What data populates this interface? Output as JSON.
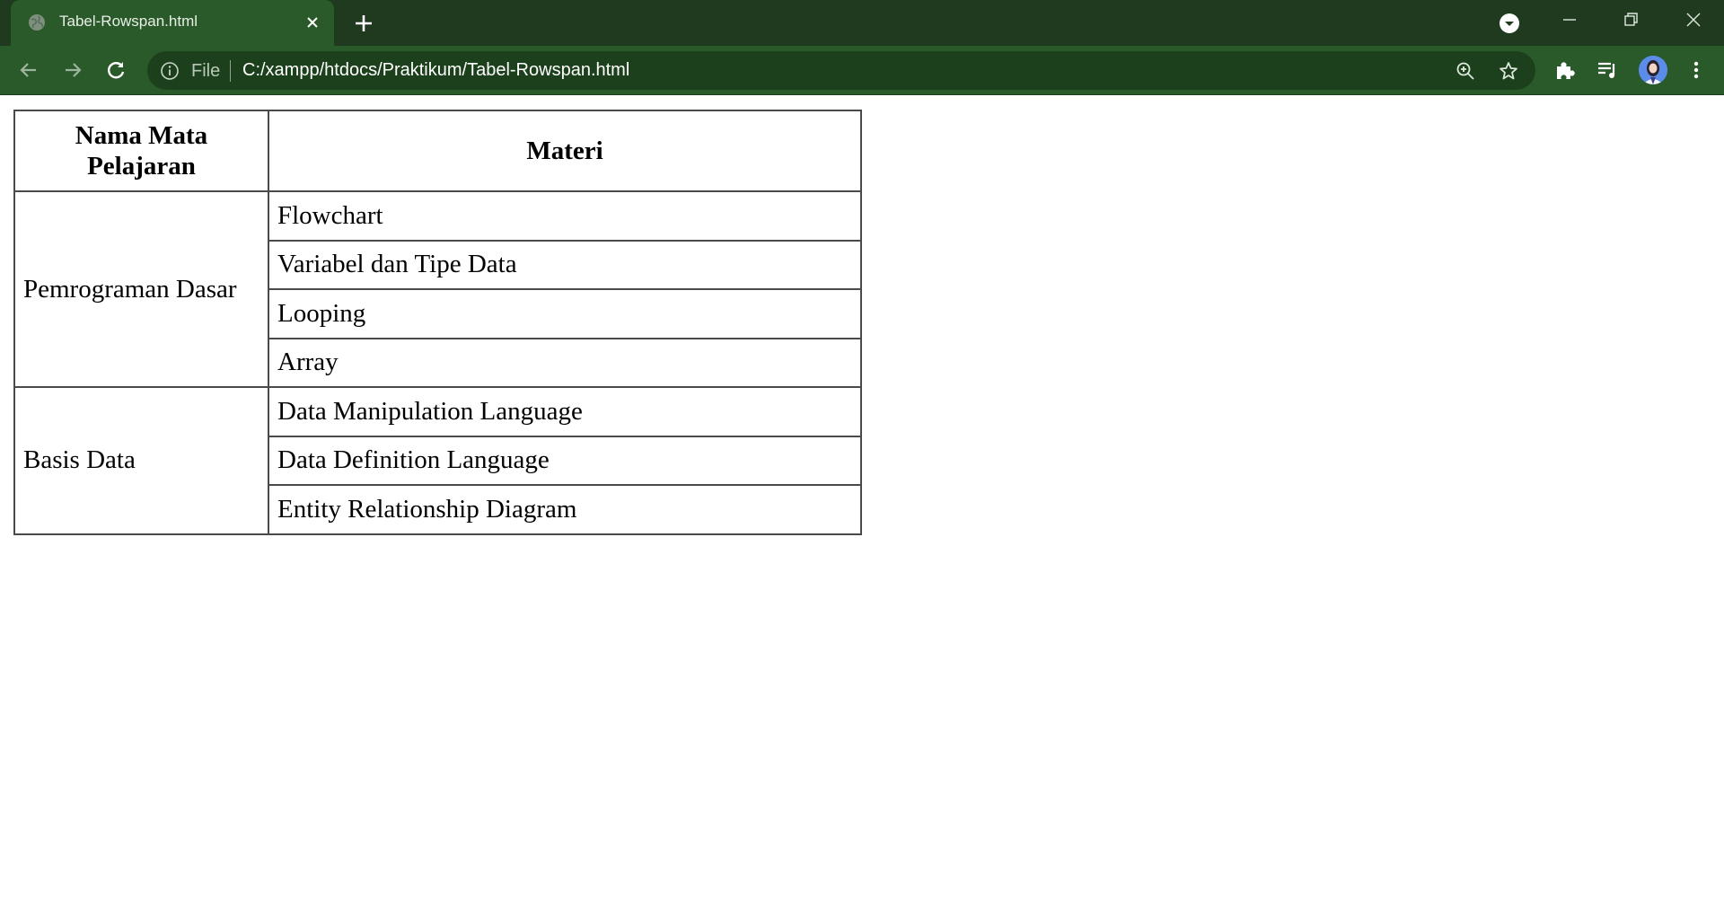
{
  "browser": {
    "tab": {
      "title": "Tabel-Rowspan.html"
    },
    "address_bar": {
      "security_label": "File",
      "url": "C:/xampp/htdocs/Praktikum/Tabel-Rowspan.html"
    },
    "colors": {
      "tabstrip": "#1f3a1f",
      "toolbar": "#2a5a2a",
      "omnibox": "#1c401c"
    },
    "icons": {
      "favicon": "globe-icon",
      "tab_close": "close-icon",
      "new_tab": "plus-icon",
      "tab_search": "chevron-down-icon",
      "minimize": "minimize-icon",
      "restore": "restore-icon",
      "close_window": "close-icon",
      "back": "arrow-left-icon",
      "forward": "arrow-right-icon",
      "reload": "reload-icon",
      "site_info": "info-icon",
      "zoom": "zoom-icon",
      "bookmark": "star-icon",
      "extensions": "puzzle-icon",
      "media": "playlist-icon",
      "profile": "avatar",
      "menu": "kebab-menu-icon"
    }
  },
  "table": {
    "headers": [
      "Nama Mata Pelajaran",
      "Materi"
    ],
    "groups": [
      {
        "subject": "Pemrograman Dasar",
        "materi": [
          "Flowchart",
          "Variabel dan Tipe Data",
          "Looping",
          "Array"
        ]
      },
      {
        "subject": "Basis Data",
        "materi": [
          "Data Manipulation Language",
          "Data Definition Language",
          "Entity Relationship Diagram"
        ]
      }
    ]
  }
}
